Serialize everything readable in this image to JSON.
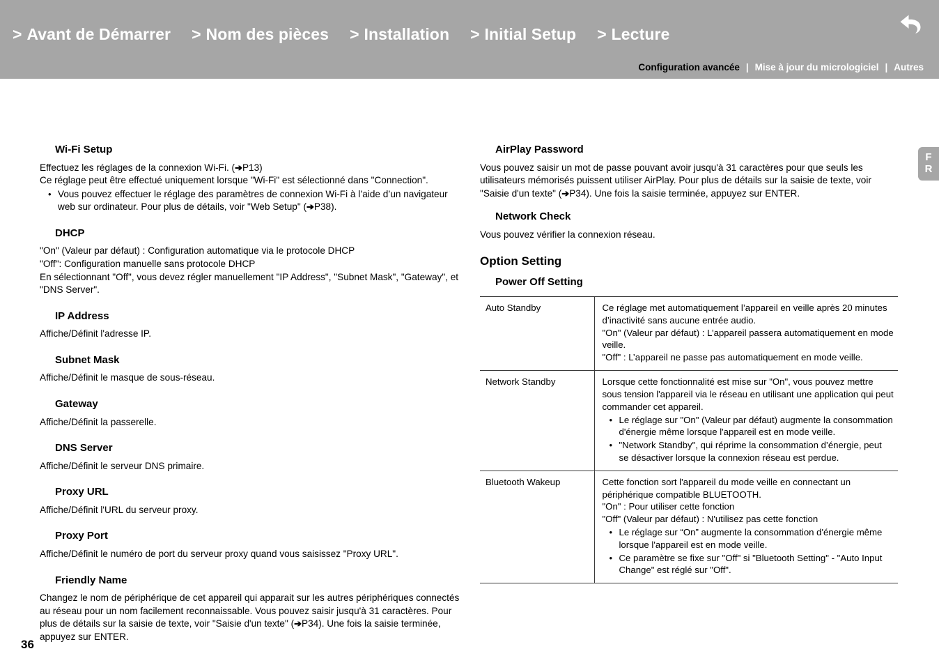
{
  "header": {
    "breadcrumb": [
      {
        "chevron": ">",
        "label": "Avant de Démarrer"
      },
      {
        "chevron": ">",
        "label": "Nom des pièces"
      },
      {
        "chevron": ">",
        "label": "Installation"
      },
      {
        "chevron": ">",
        "label": "Initial Setup"
      },
      {
        "chevron": ">",
        "label": "Lecture"
      }
    ],
    "subnav": [
      {
        "label": "Configuration avancée",
        "active": true
      },
      {
        "label": "Mise à jour du micrologiciel",
        "active": false
      },
      {
        "label": "Autres",
        "active": false
      }
    ],
    "separator": "|",
    "return_icon": "return-arrow-icon",
    "bar_color": "#a6a6a6"
  },
  "side_tab": {
    "line1": "F",
    "line2": "R"
  },
  "left_column": {
    "wifi_setup": {
      "heading": "Wi-Fi Setup",
      "line1_a": "Effectuez les réglages de la connexion Wi-Fi. (",
      "line1_arrow": "➔",
      "line1_b": "P13)",
      "line2": "Ce réglage peut être effectué uniquement lorsque \"Wi-Fi\" est sélectionné dans \"Connection\".",
      "bullet_a": "Vous pouvez effectuer le réglage des paramètres de connexion Wi-Fi à l’aide d’un navigateur web sur ordinateur. Pour plus de détails, voir \"Web Setup\" (",
      "bullet_arrow": "➔",
      "bullet_b": "P38)."
    },
    "dhcp": {
      "heading": "DHCP",
      "line1": "\"On\" (Valeur par défaut) : Configuration automatique via le protocole DHCP",
      "line2": "\"Off\": Configuration manuelle sans protocole DHCP",
      "line3": "En sélectionnant \"Off\", vous devez régler manuellement \"IP Address\", \"Subnet Mask\", \"Gateway\", et \"DNS Server\"."
    },
    "ip_address": {
      "heading": "IP Address",
      "body": "Affiche/Définit l'adresse IP."
    },
    "subnet_mask": {
      "heading": "Subnet Mask",
      "body": "Affiche/Définit le masque de sous-réseau."
    },
    "gateway": {
      "heading": "Gateway",
      "body": "Affiche/Définit la passerelle."
    },
    "dns_server": {
      "heading": "DNS Server",
      "body": "Affiche/Définit le serveur DNS primaire."
    },
    "proxy_url": {
      "heading": "Proxy URL",
      "body": "Affiche/Définit l'URL du serveur proxy."
    },
    "proxy_port": {
      "heading": "Proxy Port",
      "body": "Affiche/Définit le numéro de port du serveur proxy quand vous saisissez \"Proxy URL\"."
    },
    "friendly_name": {
      "heading": "Friendly Name",
      "body_a": "Changez le nom de périphérique de cet appareil qui apparait sur les autres périphériques connectés au réseau pour un nom facilement reconnaissable. Vous pouvez saisir jusqu'à 31 caractères. Pour plus de détails sur la saisie de texte, voir \"Saisie d'un texte\" (",
      "body_arrow": "➔",
      "body_b": "P34). Une fois la saisie terminée, appuyez sur ENTER."
    }
  },
  "right_column": {
    "airplay_password": {
      "heading": "AirPlay Password",
      "body_a": "Vous pouvez saisir un mot de passe pouvant avoir jusqu'à 31 caractères pour que seuls les utilisateurs mémorisés puissent utiliser AirPlay. Pour plus de détails sur la saisie de texte, voir \"Saisie d'un texte\" (",
      "body_arrow": "➔",
      "body_b": "P34). Une fois la saisie terminée, appuyez sur ENTER."
    },
    "network_check": {
      "heading": "Network Check",
      "body": "Vous pouvez vérifier la connexion réseau."
    },
    "option_setting": {
      "heading": "Option Setting",
      "sub_heading": "Power Off Setting"
    },
    "table": {
      "rows": [
        {
          "label": "Auto Standby",
          "lines": [
            "Ce réglage met automatiquement l’appareil en veille après 20 minutes d’inactivité sans aucune entrée audio.",
            "\"On\" (Valeur par défaut) : L’appareil passera automatiquement en mode veille.",
            "\"Off\" : L’appareil ne passe pas automatiquement en mode veille."
          ],
          "bullets": []
        },
        {
          "label": "Network Standby",
          "lines": [
            "Lorsque cette fonctionnalité est mise sur \"On\", vous pouvez mettre sous tension l'appareil via le réseau en utilisant une application qui peut commander cet appareil."
          ],
          "bullets": [
            "Le réglage sur \"On\" (Valeur par défaut) augmente la consommation d'énergie même lorsque l'appareil est en mode veille.",
            "\"Network Standby\", qui réprime la consommation d’énergie, peut se désactiver lorsque la connexion réseau est perdue."
          ]
        },
        {
          "label": "Bluetooth Wakeup",
          "lines": [
            "Cette fonction sort l'appareil du mode veille en connectant un périphérique compatible BLUETOOTH.",
            "\"On\" : Pour utiliser cette fonction",
            "\"Off\" (Valeur par défaut) : N'utilisez pas cette fonction"
          ],
          "bullets": [
            "Le réglage sur “On” augmente la consommation d'énergie même lorsque l'appareil est en mode veille.",
            "Ce paramètre se fixe sur \"Off\" si \"Bluetooth Setting\" - \"Auto Input Change\" est réglé sur \"Off\"."
          ]
        }
      ]
    }
  },
  "page_number": "36"
}
